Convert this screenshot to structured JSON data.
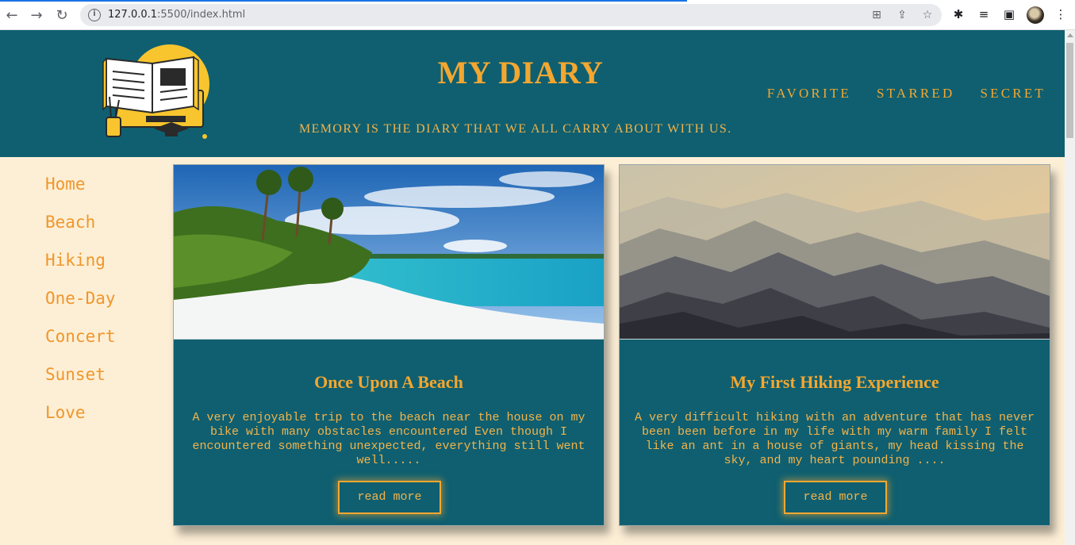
{
  "browser": {
    "url_host": "127.0.0.1",
    "url_rest": ":5500/index.html"
  },
  "header": {
    "title": "MY DIARY",
    "tagline": "MEMORY IS THE DIARY THAT WE ALL CARRY ABOUT WITH US.",
    "nav": [
      "FAVORITE",
      "STARRED",
      "SECRET"
    ]
  },
  "sidebar": {
    "items": [
      "Home",
      "Beach",
      "Hiking",
      "One-Day",
      "Concert",
      "Sunset",
      "Love"
    ]
  },
  "cards": [
    {
      "title": "Once Upon A Beach",
      "text": "A very enjoyable trip to the beach near the house on my bike with many obstacles encountered Even though I encountered something unexpected, everything still went well.....",
      "button": "read more"
    },
    {
      "title": "My First Hiking Experience",
      "text": "A very difficult hiking with an adventure that has never been been before in my life with my warm family I felt like an ant in a house of giants, my head kissing the sky, and my heart pounding ....",
      "button": "read more"
    }
  ],
  "colors": {
    "header_bg": "#0f5f70",
    "page_bg": "#fdefd6",
    "accent": "#f3a730"
  }
}
